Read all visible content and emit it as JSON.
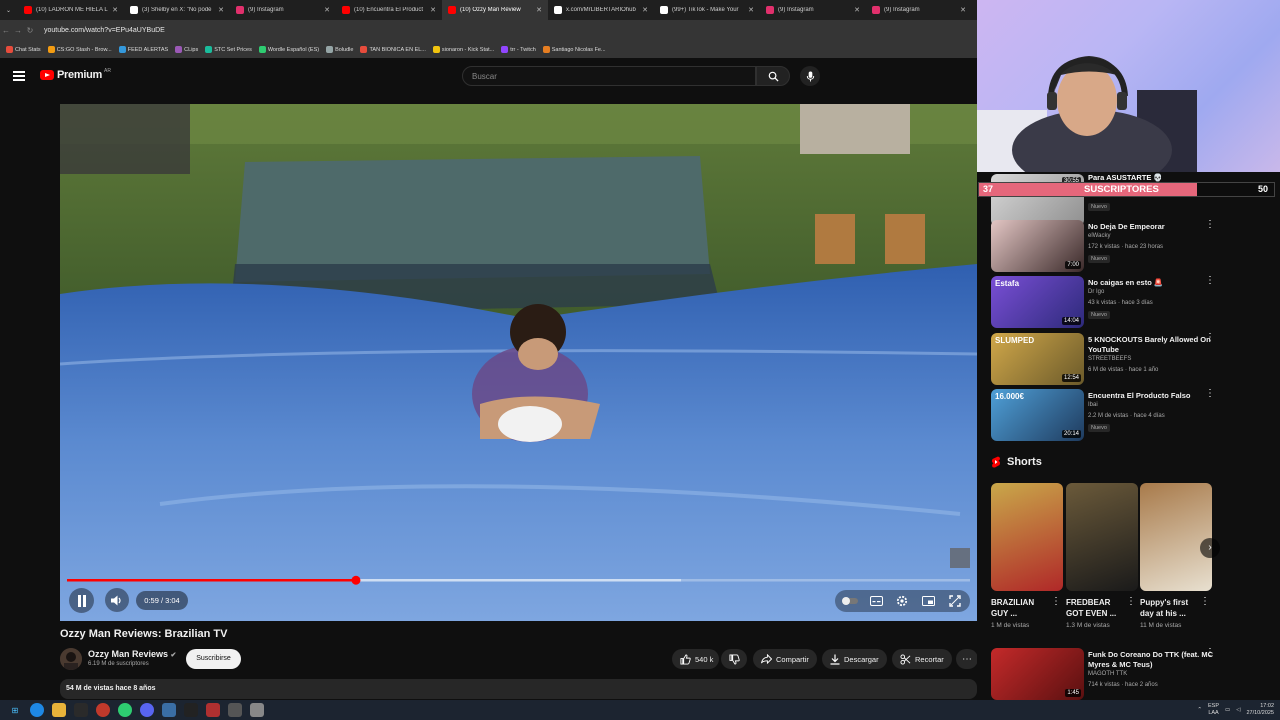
{
  "browser": {
    "tabs": [
      {
        "label": "(10) LADRÓN ME HIELA L",
        "color": "#ff0000"
      },
      {
        "label": "(3) Shelby en X: \"No podé",
        "color": "#ffffff"
      },
      {
        "label": "(9) Instagram",
        "color": "#e1306c"
      },
      {
        "label": "(10) Encuentra El Product",
        "color": "#ff0000"
      },
      {
        "label": "(10) Ozzy Man Review",
        "color": "#ff0000",
        "active": true
      },
      {
        "label": "x.com/MrLIBERTARIOhub",
        "color": "#ffffff"
      },
      {
        "label": "(99+) TikTok - Make Your",
        "color": "#ffffff"
      },
      {
        "label": "(9) Instagram",
        "color": "#e1306c"
      },
      {
        "label": "(9) Instagram",
        "color": "#e1306c"
      }
    ],
    "url": "youtube.com/watch?v=EPu4aUYBuDE",
    "bookmarks": [
      "Chat Stats",
      "CS:GO Stash - Brow...",
      "FEED ALERTAS",
      "CLips",
      "STC Set Prices",
      "Wordle Español (ES)",
      "Boludle",
      "TAN BIONICA EN EL...",
      "sionaron - Kick Stat...",
      "trr - Twitch",
      "Santiago Nicolas Fe..."
    ]
  },
  "youtube": {
    "logo_text": "Premium",
    "logo_region": "AR",
    "search_placeholder": "Buscar"
  },
  "player": {
    "time": "0:59 / 3:04",
    "progress_fraction": 0.32,
    "buffer_fraction": 0.68
  },
  "video": {
    "title": "Ozzy Man Reviews: Brazilian TV",
    "channel": "Ozzy Man Reviews",
    "subscribers": "6.19 M de suscriptores",
    "subscribe_label": "Suscribirse",
    "likes": "540 k",
    "share_label": "Compartir",
    "download_label": "Descargar",
    "clip_label": "Recortar",
    "views_date": "54 M de vistas  hace 8 años"
  },
  "overlay": {
    "alert_label": "Para ASUSTARTE 💀",
    "bar_left": "37",
    "bar_label": "SUSCRIPTORES",
    "bar_right": "50",
    "bar_fraction": 0.74
  },
  "recommendations": [
    {
      "title": "",
      "channel": "",
      "meta": "",
      "duration": "30:55",
      "badge": "Nuevo",
      "colors": [
        "#d9d9d9",
        "#8f8f8f"
      ]
    },
    {
      "title": "No Deja De Empeorar",
      "channel": "elWacky",
      "meta": "172 k vistas · hace 23 horas",
      "duration": "7:00",
      "badge": "Nuevo",
      "colors": [
        "#e3c6c4",
        "#3b2a2a"
      ]
    },
    {
      "title": "No caigas en esto 🚨",
      "channel": "Dr Igo",
      "meta": "43 k vistas · hace 3 días",
      "duration": "14:04",
      "badge": "Nuevo",
      "colors": [
        "#7a4fd6",
        "#2d2a7a"
      ],
      "thumb_text": "Estafa"
    },
    {
      "title": "5 KNOCKOUTS Barely Allowed On YouTube",
      "channel": "STREETBEEFS",
      "meta": "6 M de vistas · hace 1 año",
      "duration": "12:54",
      "badge": "",
      "colors": [
        "#d1a84a",
        "#6b5a2a"
      ],
      "thumb_text": "SLUMPED"
    },
    {
      "title": "Encuentra El Producto Falso",
      "channel": "Ibai",
      "meta": "2.2 M de vistas · hace 4 días",
      "duration": "20:14",
      "badge": "Nuevo",
      "colors": [
        "#4fa0d8",
        "#1f3b5e"
      ],
      "thumb_text": "16.000€"
    },
    {
      "title": "Funk Do Coreano Do TTK (feat. MC Myres & MC Teus)",
      "channel": "MAGOTH TTK",
      "meta": "714 k vistas · hace 2 años",
      "duration": "1:45",
      "badge": "",
      "colors": [
        "#c42a2a",
        "#5a1010"
      ]
    }
  ],
  "shorts": {
    "heading": "Shorts",
    "items": [
      {
        "title": "BRAZILIAN GUY ...",
        "views": "1 M de vistas",
        "colors": [
          "#c9a84a",
          "#b02828"
        ]
      },
      {
        "title": "FREDBEAR GOT EVEN ...",
        "views": "1.3 M de vistas",
        "colors": [
          "#6b5a3a",
          "#1a1a1a"
        ]
      },
      {
        "title": "Puppy's first day at his ...",
        "views": "11 M de vistas",
        "colors": [
          "#a87a4a",
          "#e8e0d0"
        ]
      }
    ]
  },
  "taskbar": {
    "lang": "ESP",
    "lang2": "LAA",
    "time": "17:02",
    "date": "27/10/2025"
  },
  "colors": {
    "accent": "#ff0000",
    "bar_fill": "#e5677b",
    "tarp": "#5b8ad0"
  }
}
